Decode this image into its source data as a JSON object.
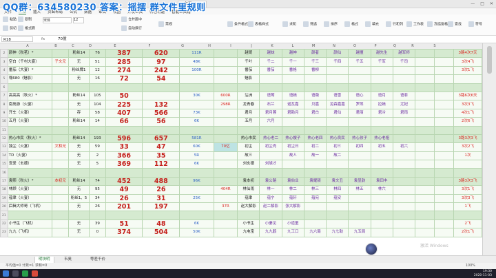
{
  "overlay": {
    "text": "QQ群：634580230 答案：摇摆  群文件里规则"
  },
  "window": {
    "doc_tab": "文案.xlsx",
    "minimize": "—",
    "maximize": "□",
    "close": "✕"
  },
  "menu": [
    "文件",
    "开始",
    "插入",
    "页面布局",
    "公式",
    "数据",
    "审阅",
    "视图",
    "开发工具",
    "特色功能",
    "智能工具箱"
  ],
  "ribbon": {
    "font_name": "宋体",
    "font_size": "12",
    "buttons": [
      "粘贴",
      "剪切",
      "复制",
      "格式刷",
      "合并居中",
      "自动换行",
      "常规",
      "条件格式",
      "表格样式",
      "求和",
      "筛选",
      "排序",
      "格式",
      "填充",
      "行和列",
      "工作表",
      "冻结窗格",
      "查找",
      "符号"
    ]
  },
  "formula_bar": {
    "cell_ref": "R18",
    "fx": "fx",
    "value": "70億"
  },
  "columns": [
    "A",
    "B",
    "C",
    "D",
    "E",
    "F",
    "G",
    "H",
    "I",
    "J",
    "K",
    "L",
    "M",
    "N",
    "O",
    "P",
    "Q",
    "R",
    "S"
  ],
  "rows": [
    {
      "n": "2",
      "s": "g",
      "c": [
        "颜神（秋茗）*",
        "",
        "粉丝14",
        "76",
        "387",
        "620",
        "111R",
        "",
        "越哥",
        "越妹",
        "越神",
        "颜者",
        "颜仙",
        "越擅",
        "越先生",
        "越军师",
        "",
        "",
        "3路4次7天"
      ]
    },
    {
      "n": "3",
      "s": "w",
      "c": [
        "空白（千村大宴）",
        "子文兄",
        "无",
        "51",
        "285",
        "97",
        "48K",
        "",
        "千叶",
        "千二",
        "千一",
        "千三",
        "千四",
        "千五",
        "千军",
        "千司",
        "",
        "",
        "3次4飞"
      ]
    },
    {
      "n": "4",
      "s": "w",
      "c": [
        "番茄（大宴）*",
        "",
        "粉丝牌1",
        "12",
        "274",
        "242",
        "100R",
        "",
        "番茄",
        "番茄",
        "番格",
        "番柳",
        "",
        "",
        "",
        "",
        "",
        "",
        "3次1飞"
      ]
    },
    {
      "n": "5",
      "s": "w",
      "c": [
        "嘿680（魅影）",
        "",
        "无",
        "16",
        "72",
        "54",
        "",
        "",
        "魅影",
        "",
        "",
        "",
        "",
        "",
        "",
        "",
        "",
        "",
        ""
      ]
    },
    {
      "n": "6",
      "s": "g",
      "c": [
        "",
        "",
        "",
        "",
        "",
        "",
        "",
        "",
        "",
        "",
        "",
        "",
        "",
        "",
        "",
        "",
        "",
        "",
        ""
      ]
    },
    {
      "n": "7",
      "s": "w",
      "c": [
        "高高高（秋火）*",
        "",
        "粉丝14",
        "105",
        "50",
        "",
        "30K",
        "600R",
        "沾洲",
        "语莺",
        "语嫣",
        "语薇",
        "语雪",
        "语心",
        "语月",
        "语菲",
        "",
        "",
        "3路6次6天"
      ]
    },
    {
      "n": "8",
      "s": "w",
      "c": [
        "南苑游（火宴）",
        "",
        "无",
        "104",
        "225",
        "132",
        "",
        "298R",
        "龙青春",
        "石兰",
        "诺瓦嘉",
        "贝嘉",
        "龙森嘉嘉",
        "罗熊",
        "拉嫣",
        "尤妃",
        "",
        "",
        "3次3飞"
      ]
    },
    {
      "n": "9",
      "s": "w",
      "c": [
        "开车（火宴）",
        "",
        "存",
        "58",
        "407",
        "566",
        "73K",
        "",
        "君月",
        "君月蓉",
        "君勘月",
        "君白",
        "君仙",
        "君丽",
        "君冷",
        "君雨",
        "",
        "",
        "4次1飞"
      ]
    },
    {
      "n": "10",
      "s": "w",
      "c": [
        "五月（火宴）",
        "",
        "粉丝14",
        "14",
        "66",
        "56",
        "6K",
        "",
        "五月",
        "六月",
        "",
        "",
        "",
        "",
        "",
        "",
        "",
        "",
        "2次6飞"
      ]
    },
    {
      "n": "11",
      "s": "g",
      "c": [
        "",
        "",
        "",
        "",
        "",
        "",
        "",
        "",
        "",
        "",
        "",
        "",
        "",
        "",
        "",
        "",
        "",
        "",
        ""
      ]
    },
    {
      "n": "12",
      "s": "g",
      "c": [
        "热心市民（秋火）*",
        "",
        "粉丝14",
        "193",
        "596",
        "657",
        "581R",
        "",
        "热心市民",
        "热心老二",
        "热心嫂子",
        "热心老四",
        "热心良民",
        "热心孩子",
        "热心老祖",
        "",
        "",
        "",
        "3路3次3飞"
      ]
    },
    {
      "n": "13",
      "s": "w",
      "c": [
        "独尘（火宴）",
        "文和兄",
        "无",
        "59",
        "33",
        "47",
        "60K",
        "70亿",
        "初尘",
        "初尘肖",
        "初尘日",
        "初二",
        "初三",
        "初四",
        "初五",
        "初六",
        "",
        "",
        "3次2飞"
      ]
    },
    {
      "n": "14",
      "s": "w",
      "c": [
        "TD（火宴）",
        "",
        "无",
        "2",
        "366",
        "35",
        "5R",
        "",
        "故三",
        "",
        "故人",
        "故一",
        "故二",
        "",
        "",
        "",
        "",
        "",
        "1次"
      ]
    },
    {
      "n": "15",
      "s": "w",
      "c": [
        "宠爱（玄德）",
        "",
        "无",
        "5",
        "369",
        "112",
        "6K",
        "",
        "刘玄德",
        "刘旭才",
        "",
        "",
        "",
        "",
        "",
        "",
        "",
        "",
        ""
      ]
    },
    {
      "n": "16",
      "s": "g",
      "c": [
        "",
        "",
        "",
        "",
        "",
        "",
        "",
        "",
        "",
        "",
        "",
        "",
        "",
        "",
        "",
        "",
        "",
        "",
        ""
      ]
    },
    {
      "n": "17",
      "s": "g",
      "c": [
        "袁熙（秋火）*",
        "本初兄",
        "粉丝14",
        "74",
        "452",
        "488",
        "96K",
        "",
        "袁本初",
        "袁公路",
        "袁伯业",
        "袁耀硕",
        "袁文丑",
        "袁显韵",
        "袁田丰",
        "",
        "",
        "",
        "3路3次3飞"
      ]
    },
    {
      "n": "18",
      "s": "w",
      "c": [
        "林顾（火宴）",
        "",
        "无",
        "95",
        "49",
        "26",
        "",
        "404R",
        "林仙雨",
        "林一",
        "林二",
        "林三",
        "林四",
        "林五",
        "林六",
        "",
        "",
        "",
        "3次1飞"
      ]
    },
    {
      "n": "19",
      "s": "w",
      "c": [
        "蕴聿（火宴）",
        "",
        "粉丝1、5",
        "34",
        "26",
        "31",
        "25K",
        "",
        "蕴聿",
        "蕴宁",
        "蕴轩",
        "蕴宛",
        "蕴安",
        "",
        "",
        "",
        "",
        "",
        "3次3飞"
      ]
    },
    {
      "n": "20",
      "s": "w",
      "c": [
        "后辑大师哥（飞机）",
        "",
        "无",
        "26",
        "201",
        "197",
        "",
        "37R",
        "赵大解影",
        "赵二解影",
        "张大解影",
        "",
        "",
        "",
        "",
        "",
        "",
        "",
        "1飞"
      ]
    },
    {
      "n": "21",
      "s": "g",
      "c": [
        "",
        "",
        "",
        "",
        "",
        "",
        "",
        "",
        "",
        "",
        "",
        "",
        "",
        "",
        "",
        "",
        "",
        "",
        ""
      ]
    },
    {
      "n": "22",
      "s": "w",
      "c": [
        "小书生（飞机）",
        "",
        "无",
        "39",
        "51",
        "48",
        "6K",
        "",
        "小书生",
        "小妻见",
        "小道童",
        "",
        "",
        "",
        "",
        "",
        "",
        "",
        "2飞"
      ]
    },
    {
      "n": "23",
      "s": "w",
      "c": [
        "九九（飞机）",
        "",
        "无",
        "0",
        "374",
        "504",
        "50K",
        "",
        "九电宝",
        "九九鹤",
        "九工口",
        "九六局",
        "九七助",
        "九五局",
        "",
        "",
        "",
        "",
        "2次1飞"
      ]
    }
  ],
  "sheet_tabs": [
    "明块明",
    "韦奥",
    "等差千价"
  ],
  "status": {
    "left": "平均值=0  计数=1  求和=0",
    "zoom": "100%"
  },
  "taskbar": {
    "time": "19:30",
    "date": "2020-11-03"
  },
  "watermark": "激活 Windows"
}
